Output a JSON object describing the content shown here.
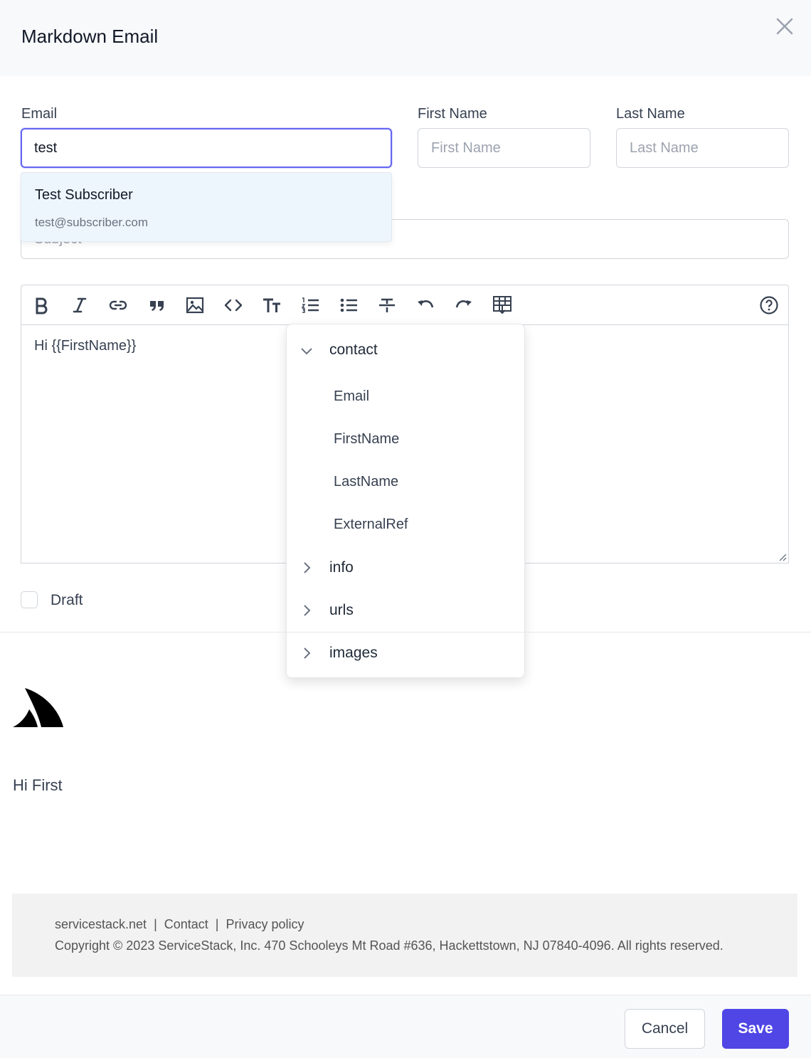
{
  "header": {
    "title": "Markdown Email",
    "close_icon": "close-icon"
  },
  "form": {
    "email": {
      "label": "Email",
      "value": "test",
      "placeholder": ""
    },
    "first_name": {
      "label": "First Name",
      "value": "",
      "placeholder": "First Name"
    },
    "last_name": {
      "label": "Last Name",
      "value": "",
      "placeholder": "Last Name"
    },
    "subject": {
      "value": "",
      "placeholder": "Subject"
    }
  },
  "autocomplete": {
    "name": "Test Subscriber",
    "email": "test@subscriber.com"
  },
  "toolbar": {
    "icons": [
      "bold-icon",
      "italic-icon",
      "link-icon",
      "quote-icon",
      "image-icon",
      "code-icon",
      "heading-icon",
      "ordered-list-icon",
      "unordered-list-icon",
      "strikethrough-icon",
      "undo-icon",
      "redo-icon",
      "insert-variable-icon",
      "help-icon"
    ]
  },
  "editor": {
    "body": "Hi {{FirstName}}"
  },
  "variables_dropdown": {
    "groups": [
      {
        "label": "contact",
        "expanded": true,
        "items": [
          "Email",
          "FirstName",
          "LastName",
          "ExternalRef"
        ]
      },
      {
        "label": "info",
        "expanded": false
      },
      {
        "label": "urls",
        "expanded": false
      },
      {
        "label": "images",
        "expanded": false
      }
    ]
  },
  "draft": {
    "label": "Draft",
    "checked": false
  },
  "preview": {
    "greeting": "Hi First",
    "footer": {
      "links": [
        "servicestack.net",
        "Contact",
        "Privacy policy"
      ],
      "separator": "|",
      "copyright": "Copyright © 2023 ServiceStack, Inc. 470 Schooleys Mt Road #636, Hackettstown, NJ 07840-4096. All rights reserved."
    }
  },
  "actions": {
    "cancel_label": "Cancel",
    "save_label": "Save"
  },
  "colors": {
    "accent": "#4f46e5",
    "focus_ring": "#6366f1",
    "autocomplete_bg": "#eef6fd",
    "footer_bg": "#f2f2f2"
  }
}
